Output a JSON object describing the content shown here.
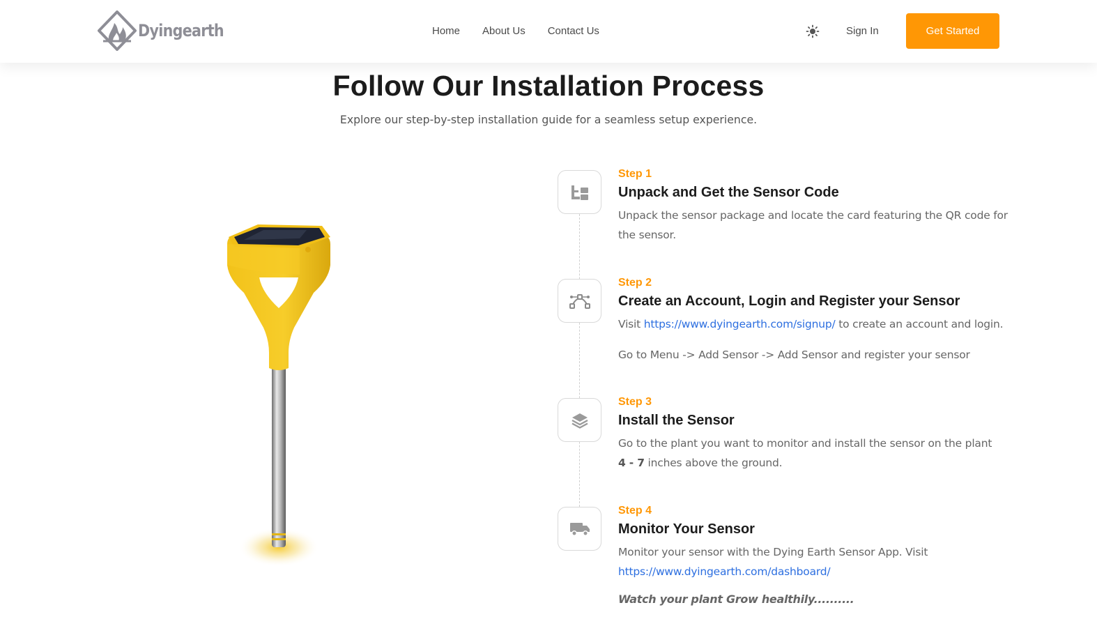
{
  "brand": {
    "name": "Dyingearth",
    "accent_color": "#ff9705",
    "logo_icon": "diamond-flame-logo"
  },
  "nav": {
    "links": [
      {
        "label": "Home"
      },
      {
        "label": "About Us"
      },
      {
        "label": "Contact Us"
      }
    ],
    "theme_icon": "sun-icon",
    "sign_in": "Sign In",
    "cta": "Get Started"
  },
  "hero": {
    "title": "Follow Our Installation Process",
    "subtitle": "Explore our step-by-step installation guide for a seamless setup experience."
  },
  "product_image": {
    "label": "Dyingearth soil sensor"
  },
  "steps": [
    {
      "label": "Step 1",
      "title": "Unpack and Get the Sensor Code",
      "icon": "package-layout-icon",
      "desc": "Unpack the sensor package and locate the card featuring the QR code for the sensor."
    },
    {
      "label": "Step 2",
      "title": "Create an Account, Login and Register your Sensor",
      "icon": "bezier-curve-icon",
      "desc_prefix": "Visit ",
      "link": "https://www.dyingearth.com/signup/",
      "desc_suffix": " to create an account and login.",
      "desc2": "Go to Menu -> Add Sensor -> Add Sensor and register your sensor"
    },
    {
      "label": "Step 3",
      "title": "Install the Sensor",
      "icon": "layers-icon",
      "desc": "Go to the plant you want to monitor and install the sensor on the plant",
      "desc_bold": "4 - 7",
      "desc_suffix": " inches above the ground."
    },
    {
      "label": "Step 4",
      "title": "Monitor Your Sensor",
      "icon": "delivery-truck-icon",
      "desc": "Monitor your sensor with the Dying Earth Sensor App. Visit",
      "link": "https://www.dyingearth.com/dashboard/",
      "closing": "Watch your plant Grow healthily.........."
    }
  ]
}
